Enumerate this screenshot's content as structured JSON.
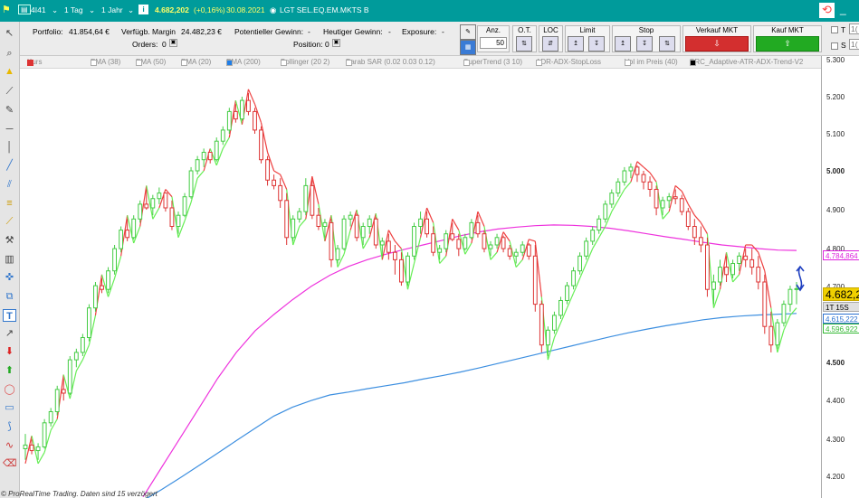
{
  "topbar": {
    "account": "4I41",
    "interval": "1 Tag",
    "period": "1 Jahr",
    "info_icon": "i",
    "price": "4.682,202",
    "change": "(+0,16%)",
    "date": "30.08.2021",
    "instrument": "LGT SEL.EQ.EM.MKTS B",
    "colors": {
      "bar": "#009b9b",
      "price": "#ffff66"
    }
  },
  "account": {
    "portfolio_label": "Portfolio:",
    "portfolio_value": "41.854,64 €",
    "margin_label": "Verfügb. Margin",
    "margin_value": "24.482,23 €",
    "orders_label": "Orders:",
    "orders_value": "0",
    "potential_label": "Potentieller Gewinn:",
    "potential_value": "-",
    "today_label": "Heutiger Gewinn:",
    "today_value": "-",
    "exposure_label": "Exposure:",
    "exposure_value": "-",
    "position_label": "Position:",
    "position_value": "0"
  },
  "order_panel": {
    "qty_label": "Anz.",
    "qty_value": "50",
    "ot_label": "O.T.",
    "loc_label": "LOC",
    "limit_label": "Limit",
    "stop_label": "Stop",
    "sell_label": "Verkauf MKT",
    "buy_label": "Kauf MKT",
    "right_t": "T",
    "right_t_val": "1(",
    "right_s": "S",
    "right_s_val": "1("
  },
  "legend": {
    "items": [
      "Kurs",
      "EMA (38)",
      "EMA (50)",
      "EMA (20)",
      "EMA (200)",
      "Bollinger (20 2)",
      "Parab SAR (0.02 0.03 0.12)",
      "SuperTrend (3 10)",
      "ADR-ADX-StopLoss",
      "Vol im Preis (40)",
      "PRC_Adaptive-ATR-ADX-Trend-V2"
    ]
  },
  "axis": {
    "ticks": [
      "5.300",
      "5.200",
      "5.100",
      "5.000",
      "4.900",
      "4.800",
      "4.700",
      "4.500",
      "4.400",
      "4.300",
      "4.200"
    ],
    "bold_ticks": [
      "5.000",
      "4.500"
    ],
    "labels": {
      "magenta": "4.784,864",
      "price": "4.682,2",
      "timer": "1T 15S",
      "blue": "4.615,222",
      "green": "4.596,922"
    }
  },
  "chart_data": {
    "type": "candlestick",
    "ylim": [
      4180,
      5310
    ],
    "series": [
      {
        "name": "EMA (200)",
        "color": "#3d8fe0",
        "values": [
          4110,
          4140,
          4172,
          4205,
          4238,
          4272,
          4305,
          4338,
          4362,
          4380,
          4395,
          4403,
          4412,
          4420,
          4428,
          4438,
          4447,
          4457,
          4468,
          4480,
          4492,
          4504,
          4516,
          4528,
          4540,
          4552,
          4563,
          4573,
          4582,
          4590,
          4598,
          4604,
          4608,
          4611,
          4613,
          4615
        ]
      },
      {
        "name": "EMA (?)",
        "color": "#ee33dd",
        "values": [
          4120,
          4200,
          4280,
          4360,
          4440,
          4510,
          4568,
          4612,
          4652,
          4688,
          4718,
          4742,
          4760,
          4775,
          4788,
          4800,
          4812,
          4825,
          4835,
          4843,
          4848,
          4852,
          4854,
          4853,
          4850,
          4845,
          4838,
          4830,
          4822,
          4815,
          4807,
          4800,
          4795,
          4790,
          4786,
          4785
        ]
      },
      {
        "name": "Trend Up",
        "color": "#66ee55"
      },
      {
        "name": "Trend Down",
        "color": "#ee4040"
      }
    ],
    "candles": [
      [
        4250,
        4290,
        4220,
        4260
      ],
      [
        4260,
        4275,
        4235,
        4245
      ],
      [
        4245,
        4265,
        4220,
        4255
      ],
      [
        4255,
        4330,
        4250,
        4320
      ],
      [
        4320,
        4360,
        4310,
        4350
      ],
      [
        4350,
        4420,
        4340,
        4410
      ],
      [
        4410,
        4440,
        4380,
        4400
      ],
      [
        4400,
        4500,
        4395,
        4490
      ],
      [
        4490,
        4520,
        4470,
        4510
      ],
      [
        4510,
        4560,
        4500,
        4550
      ],
      [
        4550,
        4640,
        4540,
        4630
      ],
      [
        4630,
        4700,
        4620,
        4690
      ],
      [
        4690,
        4710,
        4670,
        4680
      ],
      [
        4680,
        4740,
        4670,
        4730
      ],
      [
        4730,
        4800,
        4720,
        4790
      ],
      [
        4790,
        4850,
        4780,
        4840
      ],
      [
        4840,
        4870,
        4810,
        4820
      ],
      [
        4820,
        4880,
        4815,
        4870
      ],
      [
        4870,
        4920,
        4860,
        4910
      ],
      [
        4910,
        4950,
        4895,
        4900
      ],
      [
        4900,
        4935,
        4880,
        4925
      ],
      [
        4925,
        4955,
        4910,
        4940
      ],
      [
        4940,
        4910,
        4890,
        4900
      ],
      [
        4900,
        4920,
        4840,
        4850
      ],
      [
        4850,
        4890,
        4830,
        4880
      ],
      [
        4880,
        4940,
        4875,
        4930
      ],
      [
        4930,
        5010,
        4925,
        5000
      ],
      [
        5000,
        5040,
        4990,
        5030
      ],
      [
        5030,
        5060,
        5010,
        5050
      ],
      [
        5050,
        5045,
        5020,
        5030
      ],
      [
        5030,
        5090,
        5025,
        5080
      ],
      [
        5080,
        5120,
        5070,
        5110
      ],
      [
        5110,
        5170,
        5100,
        5160
      ],
      [
        5160,
        5180,
        5130,
        5140
      ],
      [
        5140,
        5200,
        5135,
        5190
      ],
      [
        5190,
        5210,
        5150,
        5160
      ],
      [
        5160,
        5170,
        5100,
        5110
      ],
      [
        5110,
        5120,
        5020,
        5030
      ],
      [
        5030,
        5040,
        4960,
        4975
      ],
      [
        4975,
        4990,
        4950,
        4960
      ],
      [
        4960,
        4980,
        4900,
        4920
      ],
      [
        4920,
        4940,
        4800,
        4820
      ],
      [
        4820,
        4880,
        4810,
        4870
      ],
      [
        4870,
        4900,
        4860,
        4890
      ],
      [
        4890,
        4980,
        4880,
        4960
      ],
      [
        4960,
        4975,
        4870,
        4880
      ],
      [
        4880,
        4900,
        4840,
        4850
      ],
      [
        4850,
        4870,
        4820,
        4860
      ],
      [
        4860,
        4870,
        4740,
        4760
      ],
      [
        4760,
        4800,
        4750,
        4790
      ],
      [
        4790,
        4880,
        4785,
        4870
      ],
      [
        4870,
        4890,
        4850,
        4880
      ],
      [
        4880,
        4885,
        4810,
        4820
      ],
      [
        4820,
        4860,
        4800,
        4850
      ],
      [
        4850,
        4880,
        4830,
        4870
      ],
      [
        4870,
        4875,
        4790,
        4800
      ],
      [
        4800,
        4820,
        4770,
        4810
      ],
      [
        4810,
        4830,
        4760,
        4780
      ],
      [
        4780,
        4800,
        4720,
        4760
      ],
      [
        4760,
        4780,
        4690,
        4700
      ],
      [
        4700,
        4780,
        4690,
        4770
      ],
      [
        4770,
        4860,
        4760,
        4850
      ],
      [
        4850,
        4890,
        4830,
        4870
      ],
      [
        4870,
        4890,
        4820,
        4830
      ],
      [
        4830,
        4850,
        4770,
        4780
      ],
      [
        4780,
        4800,
        4760,
        4790
      ],
      [
        4790,
        4840,
        4780,
        4830
      ],
      [
        4830,
        4860,
        4810,
        4815
      ],
      [
        4815,
        4830,
        4770,
        4790
      ],
      [
        4790,
        4830,
        4785,
        4820
      ],
      [
        4820,
        4870,
        4815,
        4860
      ],
      [
        4860,
        4880,
        4820,
        4830
      ],
      [
        4830,
        4840,
        4780,
        4790
      ],
      [
        4790,
        4810,
        4770,
        4800
      ],
      [
        4800,
        4830,
        4790,
        4820
      ],
      [
        4820,
        4825,
        4780,
        4790
      ],
      [
        4790,
        4800,
        4760,
        4770
      ],
      [
        4770,
        4790,
        4750,
        4780
      ],
      [
        4780,
        4810,
        4770,
        4800
      ],
      [
        4800,
        4805,
        4760,
        4770
      ],
      [
        4770,
        4800,
        4620,
        4640
      ],
      [
        4640,
        4650,
        4510,
        4530
      ],
      [
        4530,
        4580,
        4500,
        4570
      ],
      [
        4570,
        4620,
        4560,
        4610
      ],
      [
        4610,
        4660,
        4600,
        4650
      ],
      [
        4650,
        4700,
        4640,
        4690
      ],
      [
        4690,
        4740,
        4680,
        4730
      ],
      [
        4730,
        4780,
        4720,
        4770
      ],
      [
        4770,
        4820,
        4760,
        4810
      ],
      [
        4810,
        4850,
        4800,
        4840
      ],
      [
        4840,
        4880,
        4830,
        4870
      ],
      [
        4870,
        4920,
        4860,
        4910
      ],
      [
        4910,
        4950,
        4900,
        4940
      ],
      [
        4940,
        4980,
        4930,
        4970
      ],
      [
        4970,
        5010,
        4960,
        5000
      ],
      [
        5000,
        5020,
        4980,
        5010
      ],
      [
        5010,
        5015,
        4970,
        4990
      ],
      [
        4990,
        5000,
        4950,
        4970
      ],
      [
        4970,
        4985,
        4930,
        4950
      ],
      [
        4950,
        4960,
        4880,
        4900
      ],
      [
        4900,
        4930,
        4880,
        4920
      ],
      [
        4920,
        4940,
        4900,
        4930
      ],
      [
        4930,
        4950,
        4910,
        4925
      ],
      [
        4925,
        4935,
        4880,
        4890
      ],
      [
        4890,
        4900,
        4840,
        4850
      ],
      [
        4850,
        4870,
        4800,
        4820
      ],
      [
        4820,
        4850,
        4780,
        4800
      ],
      [
        4800,
        4820,
        4660,
        4680
      ],
      [
        4680,
        4720,
        4640,
        4700
      ],
      [
        4700,
        4760,
        4690,
        4740
      ],
      [
        4740,
        4770,
        4700,
        4720
      ],
      [
        4720,
        4760,
        4710,
        4750
      ],
      [
        4750,
        4780,
        4730,
        4770
      ],
      [
        4770,
        4790,
        4740,
        4760
      ],
      [
        4760,
        4790,
        4720,
        4740
      ],
      [
        4740,
        4770,
        4680,
        4700
      ],
      [
        4700,
        4720,
        4560,
        4580
      ],
      [
        4580,
        4620,
        4510,
        4530
      ],
      [
        4530,
        4600,
        4520,
        4590
      ],
      [
        4590,
        4650,
        4580,
        4640
      ],
      [
        4640,
        4690,
        4620,
        4680
      ],
      [
        4680,
        4700,
        4640,
        4682
      ]
    ]
  },
  "footer": "© ProRealTime Trading. Daten sind 15 verzögert"
}
